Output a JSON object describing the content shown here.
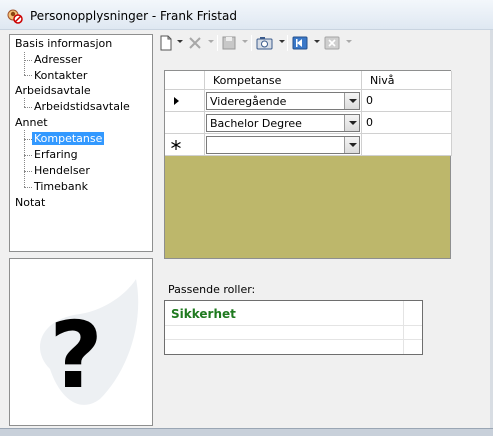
{
  "window": {
    "title": "Personopplysninger - Frank Fristad",
    "icon": "person-info-icon"
  },
  "nav": {
    "items": [
      {
        "label": "Basis informasjon",
        "level": 0
      },
      {
        "label": "Adresser",
        "level": 1
      },
      {
        "label": "Kontakter",
        "level": 1
      },
      {
        "label": "Arbeidsavtale",
        "level": 0
      },
      {
        "label": "Arbeidstidsavtale",
        "level": 1
      },
      {
        "label": "Annet",
        "level": 0
      },
      {
        "label": "Kompetanse",
        "level": 1,
        "selected": true
      },
      {
        "label": "Erfaring",
        "level": 1
      },
      {
        "label": "Hendelser",
        "level": 1
      },
      {
        "label": "Timebank",
        "level": 1
      },
      {
        "label": "Notat",
        "level": 0
      }
    ]
  },
  "photo": {
    "placeholder_icon": "question-mark-icon"
  },
  "toolbar": {
    "buttons": [
      {
        "icon": "new-document-icon",
        "enabled": true
      },
      {
        "icon": "delete-icon",
        "enabled": false
      },
      {
        "icon": "save-icon",
        "enabled": false
      },
      {
        "icon": "camera-icon",
        "enabled": true
      },
      {
        "icon": "first-record-icon",
        "enabled": true
      },
      {
        "icon": "close-record-icon",
        "enabled": false
      }
    ]
  },
  "grid": {
    "columns": [
      "Kompetanse",
      "Nivå"
    ],
    "rows": [
      {
        "indicator": "current-row-arrow",
        "competence": "Videregående",
        "level": "0"
      },
      {
        "indicator": "",
        "competence": "Bachelor Degree",
        "level": "0"
      },
      {
        "indicator": "new-row-asterisk",
        "competence": "",
        "level": ""
      }
    ],
    "background_color": "#bdb76b"
  },
  "roles": {
    "label": "Passende roller:",
    "items": [
      "Sikkerhet"
    ],
    "item_color": "#1f7a1f"
  },
  "colors": {
    "selection": "#3399ff"
  }
}
